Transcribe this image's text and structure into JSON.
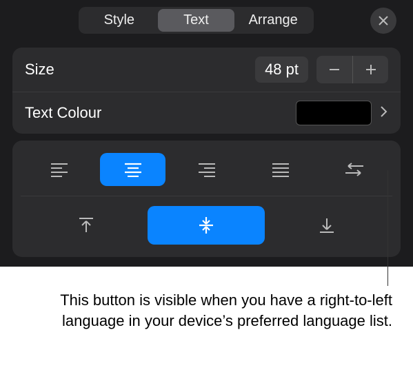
{
  "tabs": {
    "style": "Style",
    "text": "Text",
    "arrange": "Arrange"
  },
  "size": {
    "label": "Size",
    "value": "48 pt"
  },
  "color": {
    "label": "Text Colour"
  },
  "callout": "This button is visible when you have a right-to-left language in your device’s preferred language list."
}
